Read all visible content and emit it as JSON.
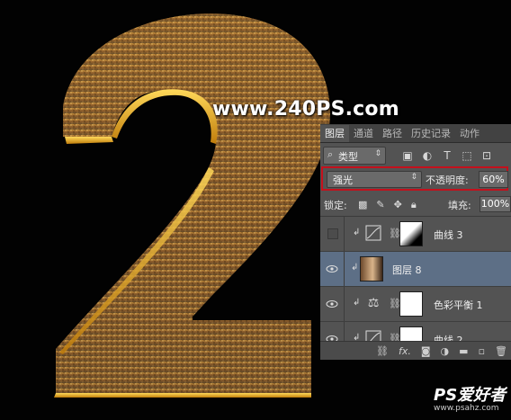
{
  "watermark": "www.240PS.com",
  "panel": {
    "tabs": [
      "图层",
      "通道",
      "路径",
      "历史记录",
      "动作"
    ],
    "filter": {
      "value": "类型",
      "icons": [
        "image-filter-icon",
        "adjustment-filter-icon",
        "type-filter-icon",
        "shape-filter-icon",
        "smart-object-filter-icon"
      ]
    },
    "blend_mode": "强光",
    "opacity_label": "不透明度:",
    "opacity_value": "60%",
    "lock_label": "锁定:",
    "fill_label": "填充:",
    "fill_value": "100%",
    "layers": [
      {
        "name": "曲线 3",
        "visible": false,
        "selected": false
      },
      {
        "name": "图层 8",
        "visible": true,
        "selected": true
      },
      {
        "name": "色彩平衡 1",
        "visible": true,
        "selected": false
      },
      {
        "name": "曲线 2",
        "visible": true,
        "selected": false
      }
    ]
  },
  "logo": {
    "main": "PS爱好者",
    "sub": "www.psahz.com"
  },
  "colors": {
    "gold": "#d9a51e",
    "panel_bg": "#535353",
    "selected_layer": "#5d6f86",
    "highlight": "#c4101c"
  }
}
